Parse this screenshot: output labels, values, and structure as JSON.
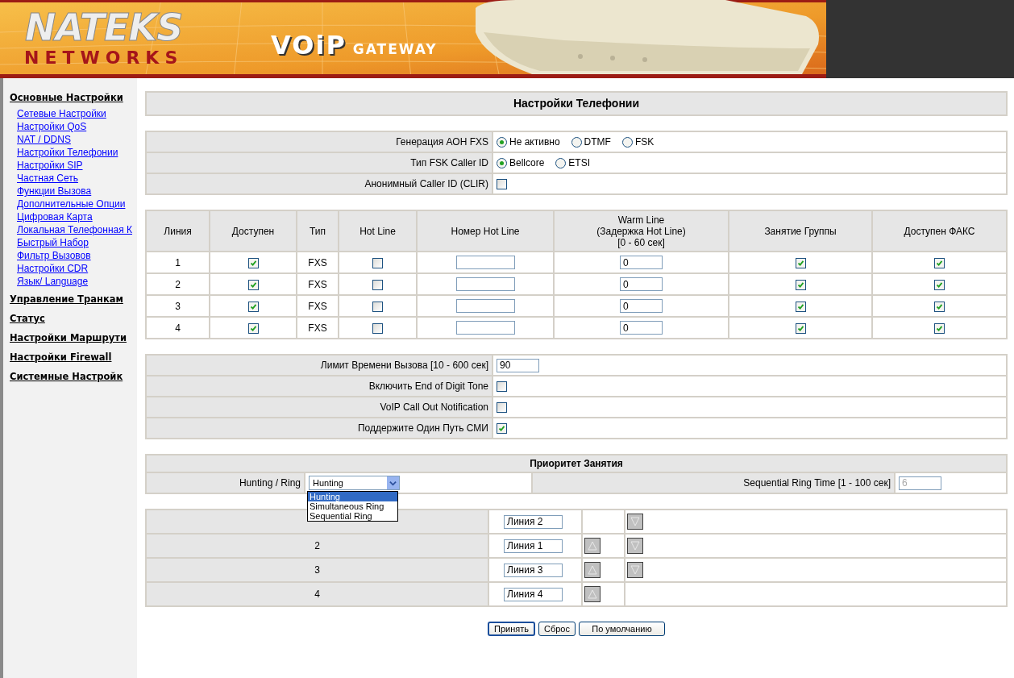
{
  "header": {
    "logo_top": "NATEKS",
    "logo_bottom": "NETWORKS",
    "product": "VOiP",
    "product_sub": "GATEWAY"
  },
  "sidebar": {
    "sections": [
      {
        "label": "Основные Настройки",
        "items": [
          "Сетевые Настройки",
          "Настройки QoS",
          "NAT / DDNS",
          "Настройки Телефонии",
          "Настройки SIP",
          "Частная Сеть",
          "Функции Вызова",
          "Дополнительные Опции",
          "Цифровая Карта",
          "Локальная Телефонная К",
          "Быстрый Набор",
          "Фильтр Вызовов",
          "Настройки CDR",
          "Язык/ Language"
        ]
      },
      {
        "label": "Управление Транкам"
      },
      {
        "label": "Статус"
      },
      {
        "label": "Настройки Маршрути"
      },
      {
        "label": "Настройки Firewall"
      },
      {
        "label": "Системные Настройк"
      }
    ]
  },
  "page_title": "Настройки Телефонии",
  "caller_id": [
    {
      "kind": "radio",
      "label": "Генерация АОН FXS",
      "options": [
        {
          "label": "Не активно",
          "selected": true
        },
        {
          "label": "DTMF",
          "selected": false
        },
        {
          "label": "FSK",
          "selected": false
        }
      ]
    },
    {
      "kind": "radio",
      "label": "Тип FSK Caller ID",
      "options": [
        {
          "label": "Bellcore",
          "selected": true
        },
        {
          "label": "ETSI",
          "selected": false
        }
      ]
    },
    {
      "kind": "checkbox",
      "label": "Анонимный Caller ID (CLIR)",
      "checked": false
    }
  ],
  "lines_table": {
    "columns": [
      "Линия",
      "Доступен",
      "Тип",
      "Hot Line",
      "Номер Hot Line",
      "Warm Line\n(Задержка Hot Line)\n[0 - 60 сек]",
      "Занятие Группы",
      "Доступен ФАКС"
    ],
    "rows": [
      {
        "line": "1",
        "enabled": true,
        "type": "FXS",
        "hot_line": false,
        "warm_line": "0",
        "group": true,
        "fax": true
      },
      {
        "line": "2",
        "enabled": true,
        "type": "FXS",
        "hot_line": false,
        "warm_line": "0",
        "group": true,
        "fax": true
      },
      {
        "line": "3",
        "enabled": true,
        "type": "FXS",
        "hot_line": false,
        "warm_line": "0",
        "group": true,
        "fax": true
      },
      {
        "line": "4",
        "enabled": true,
        "type": "FXS",
        "hot_line": false,
        "warm_line": "0",
        "group": true,
        "fax": true
      }
    ]
  },
  "call_settings": [
    {
      "kind": "text",
      "label": "Лимит Времени Вызова [10 - 600 сек]",
      "value": "90"
    },
    {
      "kind": "checkbox",
      "label": "Включить End of Digit Tone",
      "checked": false
    },
    {
      "kind": "checkbox",
      "label": "VoIP Call Out Notification",
      "checked": false
    },
    {
      "kind": "checkbox",
      "label": "Поддержите Один Путь СМИ",
      "checked": true
    }
  ],
  "priority": {
    "title": "Приоритет Занятия",
    "mode_label": "Hunting / Ring",
    "mode_value": "Hunting",
    "expanded": true,
    "options": [
      {
        "label": "Hunting",
        "selected": true
      },
      {
        "label": "Simultaneous Ring",
        "selected": false
      },
      {
        "label": "Sequential Ring",
        "selected": false
      }
    ],
    "time_label": "Sequential Ring Time [1 - 100 сек]",
    "time_value": "6",
    "time_disabled": true,
    "order": [
      {
        "line": "Линия 2",
        "up": false,
        "down": true
      },
      {
        "number": "2",
        "line": "Линия 1",
        "up": true,
        "down": true
      },
      {
        "number": "3",
        "line": "Линия 3",
        "up": true,
        "down": true
      },
      {
        "number": "4",
        "line": "Линия 4",
        "up": true,
        "down": false
      }
    ]
  },
  "buttons": [
    {
      "label": "Принять",
      "focused": true
    },
    {
      "label": "Сброс",
      "focused": false
    },
    {
      "label": "По умолчанию",
      "focused": false
    }
  ]
}
